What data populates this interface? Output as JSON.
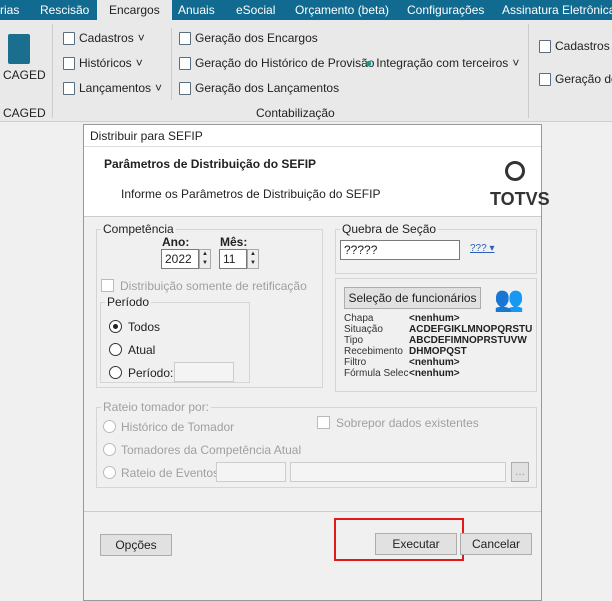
{
  "tabs": [
    "rias",
    "Rescisão",
    "Encargos",
    "Anuais",
    "eSocial",
    "Orçamento (beta)",
    "Configurações",
    "Assinatura Eletrônica"
  ],
  "ribbon": {
    "caged": "CAGED",
    "caged_group": "CAGED",
    "cadastros": "Cadastros",
    "historicos": "Históricos",
    "lancamentos": "Lançamentos",
    "geracao_encargos": "Geração dos Encargos",
    "geracao_historico": "Geração do Histórico de Provisão",
    "geracao_lancamentos": "Geração dos Lançamentos",
    "integracao": "Integração com terceiros",
    "contabilizacao_group": "Contabilização",
    "cadastros_r": "Cadastros R",
    "geracao_r": "Geração do"
  },
  "dialog": {
    "title": "Distribuir para SEFIP",
    "heading": "Parâmetros de Distribuição do SEFIP",
    "subheading": "Informe os Parâmetros de Distribuição do SEFIP",
    "logo": "TOTVS",
    "competencia": {
      "legend": "Competência",
      "ano_label": "Ano:",
      "ano": "2022",
      "mes_label": "Mês:",
      "mes": "11"
    },
    "retificacao": "Distribuição somente de retificação",
    "periodo": {
      "legend": "Período",
      "todos": "Todos",
      "atual": "Atual",
      "periodo": "Período:",
      "selected": "Todos"
    },
    "quebra": {
      "legend": "Quebra de Seção",
      "value": "?????",
      "menu": "???"
    },
    "selecao": {
      "button": "Seleção de funcionários",
      "rows": [
        {
          "label": "Chapa",
          "value": "<nenhum>"
        },
        {
          "label": "Situação",
          "value": "ACDEFGIKLMNOPQRSTU"
        },
        {
          "label": "Tipo",
          "value": "ABCDEFIMNOPRSTUVW"
        },
        {
          "label": "Recebimento",
          "value": "DHMOPQST"
        },
        {
          "label": "Filtro",
          "value": "<nenhum>"
        },
        {
          "label": "Fórmula Selec",
          "value": "<nenhum>"
        }
      ]
    },
    "rateio": {
      "legend": "Rateio tomador por:",
      "historico": "Histórico de Tomador",
      "sobrepor": "Sobrepor dados existentes",
      "tomadores": "Tomadores da Competência Atual",
      "eventos": "Rateio de Eventos:",
      "browse": "..."
    },
    "opcoes": "Opções",
    "executar": "Executar",
    "cancelar": "Cancelar",
    "highlight_color": "#e0191b"
  }
}
